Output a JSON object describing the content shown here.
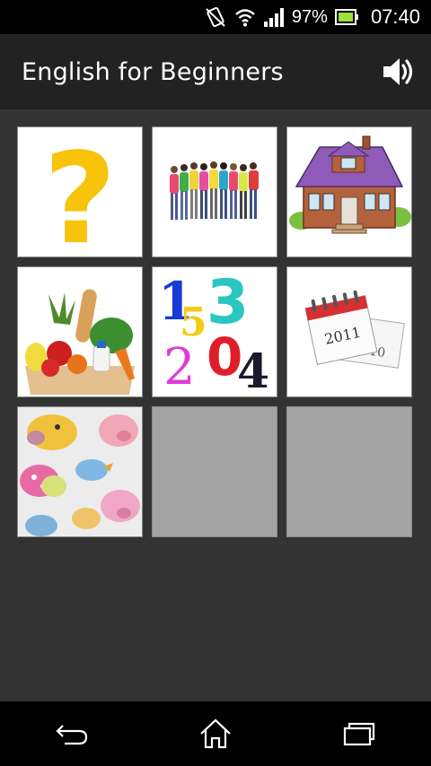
{
  "status_bar": {
    "battery_percent": "97%",
    "time": "07:40",
    "icons": [
      "vibrate-off-icon",
      "wifi-icon",
      "signal-icon",
      "battery-icon"
    ]
  },
  "action_bar": {
    "title": "English for Beginners",
    "sound_icon": "speaker-icon"
  },
  "grid": {
    "tiles": [
      {
        "name": "tile-question",
        "icon": "question-mark"
      },
      {
        "name": "tile-people",
        "icon": "group-of-people"
      },
      {
        "name": "tile-house",
        "icon": "house"
      },
      {
        "name": "tile-food",
        "icon": "grocery-bag"
      },
      {
        "name": "tile-numbers",
        "icon": "numbers",
        "digits": [
          "1",
          "5",
          "3",
          "2",
          "0",
          "4"
        ]
      },
      {
        "name": "tile-calendar",
        "icon": "calendar",
        "years": [
          "2011",
          "2010"
        ]
      },
      {
        "name": "tile-animals",
        "icon": "animals"
      },
      {
        "name": "tile-empty-1",
        "icon": "empty"
      },
      {
        "name": "tile-empty-2",
        "icon": "empty"
      }
    ]
  },
  "nav_bar": {
    "buttons": [
      "back-icon",
      "home-icon",
      "recent-apps-icon"
    ]
  },
  "colors": {
    "background": "#333333",
    "action_bar": "#222222",
    "empty_tile": "#a3a3a3"
  }
}
